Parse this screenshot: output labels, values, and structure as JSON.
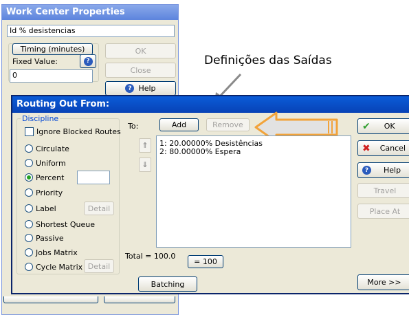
{
  "wc": {
    "title": "Work Center Properties",
    "name_value": "Id % desistencias",
    "timing_label": "Timing (minutes)",
    "fixed_value_label": "Fixed Value:",
    "fixed_value": "0",
    "ok_label": "OK",
    "close_label": "Close",
    "help_label": "Help"
  },
  "callout": {
    "text": "Definições das Saídas"
  },
  "routing": {
    "title": "Routing Out From:",
    "discipline_label": "Discipline",
    "ignore_blocked_label": "Ignore Blocked Routes",
    "options": {
      "circulate": "Circulate",
      "uniform": "Uniform",
      "percent": "Percent",
      "priority": "Priority",
      "label": "Label",
      "shortest_queue": "Shortest Queue",
      "passive": "Passive",
      "jobs_matrix": "Jobs Matrix",
      "cycle_matrix": "Cycle Matrix"
    },
    "selected_option": "percent",
    "percent_value": "",
    "detail_label": "Detail",
    "to_label": "To:",
    "add_label": "Add",
    "remove_label": "Remove",
    "routes": [
      "1: 20.00000% Desistências",
      "2: 80.00000% Espera"
    ],
    "total_text": "Total = 100.0",
    "eq100_label": "= 100",
    "batching_label": "Batching",
    "ok_label": "OK",
    "cancel_label": "Cancel",
    "help_label": "Help",
    "travel_label": "Travel",
    "place_at_label": "Place At",
    "more_label": "More >>"
  },
  "colors": {
    "title_active": "#0842b6",
    "title_inactive": "#7a9ae5",
    "legend_text": "#0046d5",
    "annotation_arrow": "#f2a33a"
  }
}
